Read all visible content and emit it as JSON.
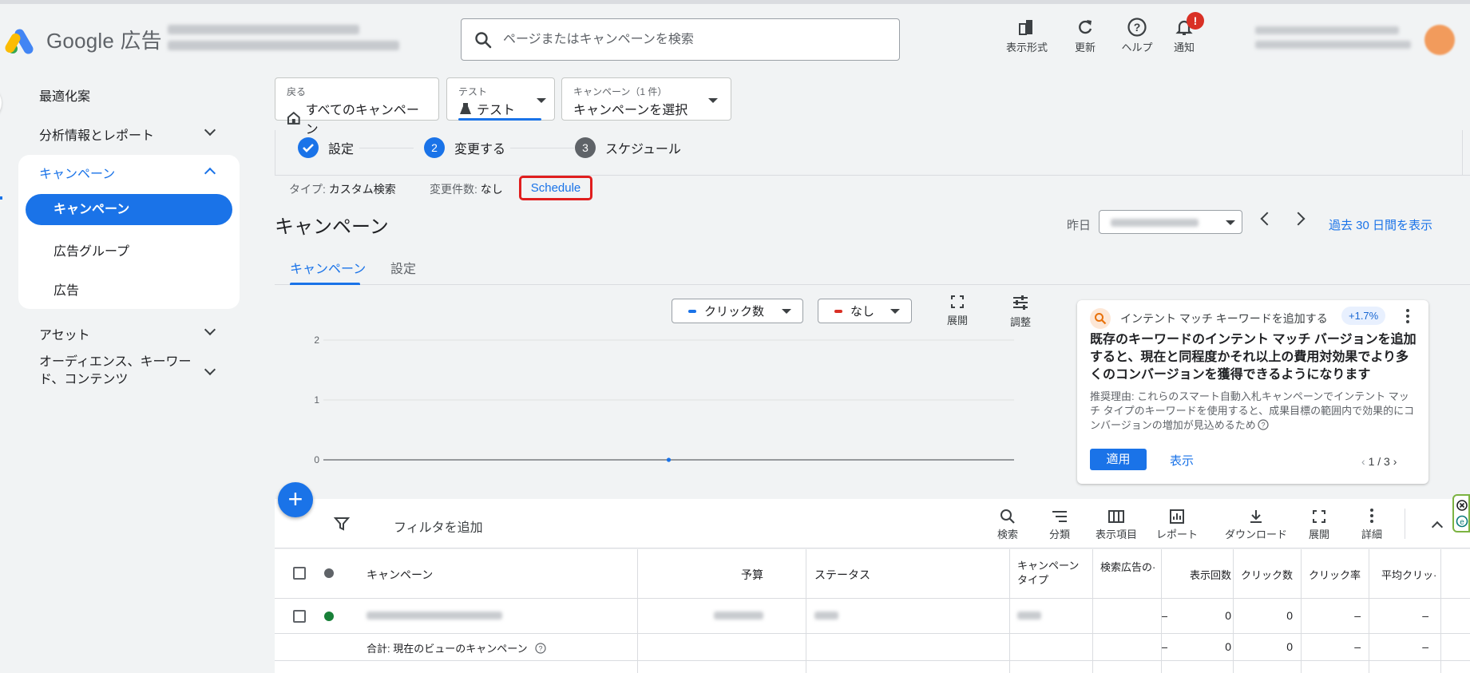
{
  "header": {
    "product_name": "Google 広告",
    "search_placeholder": "ページまたはキャンペーンを検索",
    "tools": [
      {
        "label": "表示形式",
        "icon": "appearance-icon"
      },
      {
        "label": "更新",
        "icon": "refresh-icon"
      },
      {
        "label": "ヘルプ",
        "icon": "help-icon"
      },
      {
        "label": "通知",
        "icon": "bell-icon",
        "badge": "!"
      }
    ]
  },
  "sidebar": {
    "items": [
      {
        "label": "最適化案"
      },
      {
        "label": "分析情報とレポート"
      },
      {
        "label": "キャンペーン"
      },
      {
        "label": "キャンペーン"
      },
      {
        "label": "広告グループ"
      },
      {
        "label": "広告"
      },
      {
        "label": "アセット"
      },
      {
        "label": "オーディエンス、キーワード、コンテンツ",
        "line1": "オーディエンス、キーワー",
        "line2": "ド、コンテンツ"
      }
    ]
  },
  "context": {
    "back_small": "戻る",
    "back_big": "すべてのキャンペーン",
    "test_small": "テスト",
    "test_big": "テスト",
    "campaign_small": "キャンペーン（1 件）",
    "campaign_big": "キャンペーンを選択"
  },
  "steps": [
    {
      "num": "",
      "label": "設定"
    },
    {
      "num": "2",
      "label": "変更する"
    },
    {
      "num": "3",
      "label": "スケジュール"
    }
  ],
  "meta": {
    "type_label": "タイプ:",
    "type_value": "カスタム検索",
    "changes_label": "変更件数:",
    "changes_value": "なし",
    "schedule_link": "Schedule"
  },
  "page": {
    "title": "キャンペーン",
    "date_label": "昨日",
    "period_link": "過去 30 日間を表示"
  },
  "tabs": [
    "キャンペーン",
    "設定"
  ],
  "chart_controls": {
    "metric1": "クリック数",
    "metric2": "なし",
    "expand": "展開",
    "adjust": "調整"
  },
  "chart_data": {
    "type": "line",
    "title": "",
    "xlabel": "",
    "ylabel": "",
    "ylim": [
      0,
      2
    ],
    "yticks": [
      "2",
      "1",
      "0"
    ],
    "series": [
      {
        "values": [
          0
        ]
      }
    ]
  },
  "recommendation": {
    "header": "インテント マッチ キーワードを追加する",
    "uplift": "+1.7%",
    "title": "既存のキーワードのインテント マッチ バージョンを追加すると、現在と同程度かそれ以上の費用対効果でより多くのコンバージョンを獲得できるようになります",
    "body": "推奨理由: これらのスマート自動入札キャンペーンでインテント マッチ タイプのキーワードを使用すると、成果目標の範囲内で効果的にコンバージョンの増加が見込めるため",
    "apply": "適用",
    "view": "表示",
    "pager": "1 / 3"
  },
  "table_toolbar": {
    "filter": "フィルタを追加",
    "buttons": [
      {
        "label": "検索",
        "icon": "search-icon"
      },
      {
        "label": "分類",
        "icon": "segment-icon"
      },
      {
        "label": "表示項目",
        "icon": "columns-icon"
      },
      {
        "label": "レポート",
        "icon": "report-icon"
      },
      {
        "label": "ダウンロード",
        "icon": "download-icon"
      },
      {
        "label": "展開",
        "icon": "expand-icon"
      },
      {
        "label": "詳細",
        "icon": "more-icon"
      }
    ]
  },
  "table": {
    "headers": [
      "キャンペーン",
      "予算",
      "ステータス",
      "キャンペーン\nタイプ",
      "検索広告の·",
      "表示回数",
      "クリック数",
      "クリック率",
      "平均クリッ·"
    ],
    "header_type_line1": "キャンペーン",
    "header_type_line2": "タイプ",
    "row": [
      "–",
      "0",
      "0",
      "–",
      "–"
    ],
    "total_label": "合計: 現在のビューのキャンペーン",
    "total": [
      "–",
      "0",
      "0",
      "–",
      "–"
    ]
  }
}
